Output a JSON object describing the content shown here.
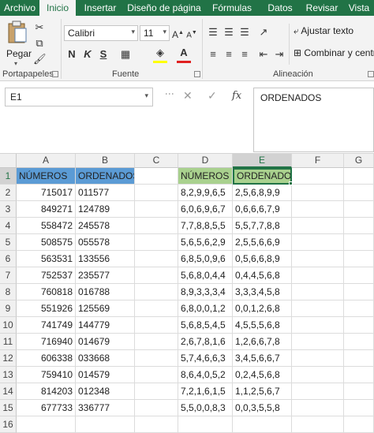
{
  "tabs": [
    "Archivo",
    "Inicio",
    "Insertar",
    "Diseño de página",
    "Fórmulas",
    "Datos",
    "Revisar",
    "Vista"
  ],
  "ribbon": {
    "clipboard": {
      "paste_label": "Pegar",
      "group_label": "Portapapeles"
    },
    "font": {
      "font_name": "Calibri",
      "font_size": "11",
      "bold": "N",
      "italic": "K",
      "underline": "S",
      "group_label": "Fuente"
    },
    "alignment": {
      "wrap_text": "Ajustar texto",
      "merge_center": "Combinar y centrar",
      "group_label": "Alineación"
    }
  },
  "formula_bar": {
    "name_box": "E1",
    "fx": "fx",
    "content": "ORDENADOS"
  },
  "colors": {
    "header_blue": "#5b9bd5",
    "header_green": "#a9d18e",
    "excel_green": "#217346"
  },
  "grid": {
    "columns": [
      "A",
      "B",
      "C",
      "D",
      "E",
      "F",
      "G"
    ],
    "rows": [
      {
        "n": "1",
        "a": "NÚMEROS",
        "b": "ORDENADOS",
        "d": "NÚMEROS",
        "e": "ORDENADOS"
      },
      {
        "n": "2",
        "a": "715017",
        "b": "011577",
        "d": "8,2,9,9,6,5",
        "e": "2,5,6,8,9,9"
      },
      {
        "n": "3",
        "a": "849271",
        "b": "124789",
        "d": "6,0,6,9,6,7",
        "e": "0,6,6,6,7,9"
      },
      {
        "n": "4",
        "a": "558472",
        "b": "245578",
        "d": "7,7,8,8,5,5",
        "e": "5,5,7,7,8,8"
      },
      {
        "n": "5",
        "a": "508575",
        "b": "055578",
        "d": "5,6,5,6,2,9",
        "e": "2,5,5,6,6,9"
      },
      {
        "n": "6",
        "a": "563531",
        "b": "133556",
        "d": "6,8,5,0,9,6",
        "e": "0,5,6,6,8,9"
      },
      {
        "n": "7",
        "a": "752537",
        "b": "235577",
        "d": "5,6,8,0,4,4",
        "e": "0,4,4,5,6,8"
      },
      {
        "n": "8",
        "a": "760818",
        "b": "016788",
        "d": "8,9,3,3,3,4",
        "e": "3,3,3,4,5,8"
      },
      {
        "n": "9",
        "a": "551926",
        "b": "125569",
        "d": "6,8,0,0,1,2",
        "e": "0,0,1,2,6,8"
      },
      {
        "n": "10",
        "a": "741749",
        "b": "144779",
        "d": "5,6,8,5,4,5",
        "e": "4,5,5,5,6,8"
      },
      {
        "n": "11",
        "a": "716940",
        "b": "014679",
        "d": "2,6,7,8,1,6",
        "e": "1,2,6,6,7,8"
      },
      {
        "n": "12",
        "a": "606338",
        "b": "033668",
        "d": "5,7,4,6,6,3",
        "e": "3,4,5,6,6,7"
      },
      {
        "n": "13",
        "a": "759410",
        "b": "014579",
        "d": "8,6,4,0,5,2",
        "e": "0,2,4,5,6,8"
      },
      {
        "n": "14",
        "a": "814203",
        "b": "012348",
        "d": "7,2,1,6,1,5",
        "e": "1,1,2,5,6,7"
      },
      {
        "n": "15",
        "a": "677733",
        "b": "336777",
        "d": "5,5,0,0,8,3",
        "e": "0,0,3,5,5,8"
      },
      {
        "n": "16",
        "a": "",
        "b": "",
        "d": "",
        "e": ""
      }
    ]
  }
}
